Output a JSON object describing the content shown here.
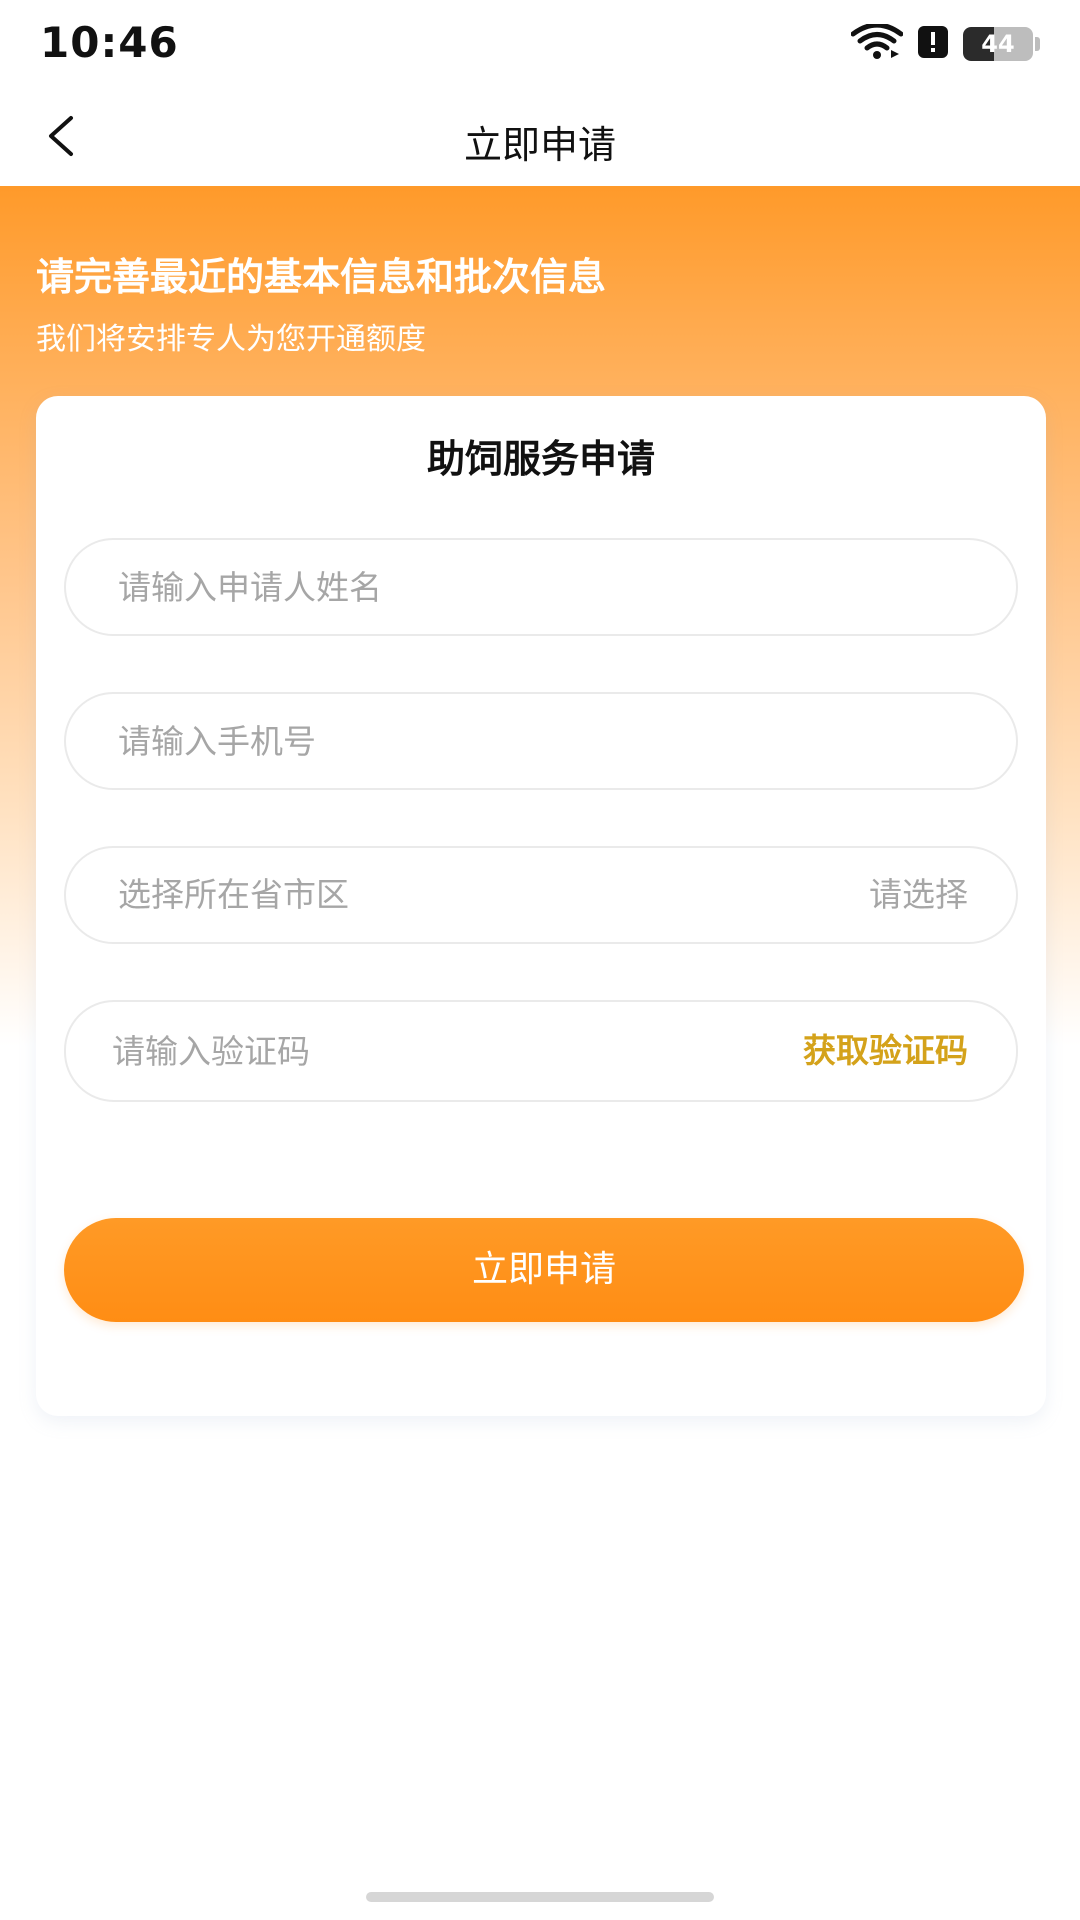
{
  "status_bar": {
    "time": "10:46",
    "battery_level": 44,
    "battery_text": "44",
    "icons": [
      "wifi-icon",
      "alert-notification-icon",
      "battery-icon"
    ]
  },
  "nav": {
    "title": "立即申请",
    "back_icon": "chevron-left-icon"
  },
  "hero": {
    "title": "请完善最近的基本信息和批次信息",
    "subtitle": "我们将安排专人为您开通额度"
  },
  "form": {
    "title": "助饲服务申请",
    "name_placeholder": "请输入申请人姓名",
    "phone_placeholder": "请输入手机号",
    "region_label": "选择所在省市区",
    "region_value": "请选择",
    "code_placeholder": "请输入验证码",
    "get_code_label": "获取验证码",
    "submit_label": "立即申请"
  },
  "colors": {
    "brand": "#ff8d14",
    "link": "#d4a21a",
    "placeholder": "#a6a6a6"
  }
}
